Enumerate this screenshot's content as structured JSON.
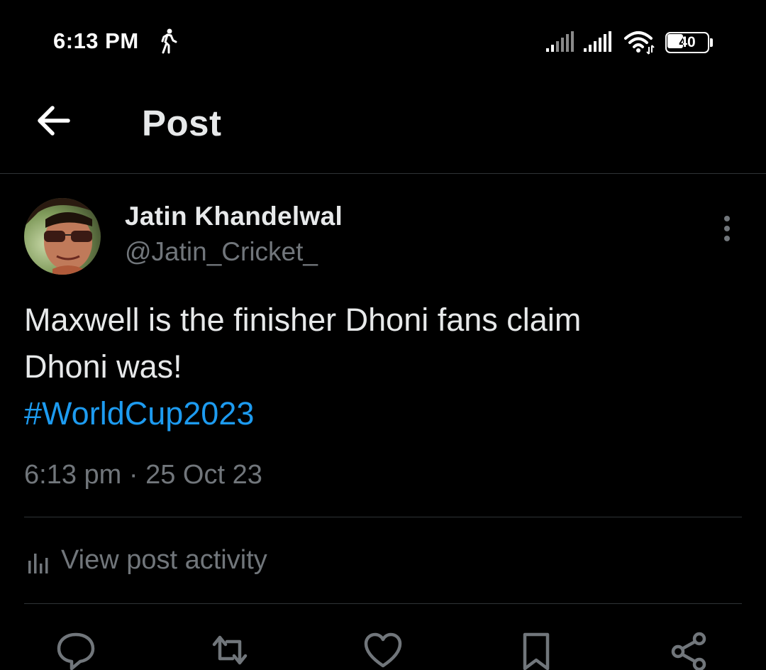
{
  "status_bar": {
    "time": "6:13 PM",
    "battery_level": "40",
    "icons": [
      "walk-icon",
      "signal-icon",
      "signal-icon",
      "wifi-icon",
      "battery-icon"
    ]
  },
  "header": {
    "title": "Post",
    "back_icon": "arrow-left-icon"
  },
  "post": {
    "author": {
      "display_name": "Jatin Khandelwal",
      "handle": "@Jatin_Cricket_"
    },
    "text_lines": [
      "Maxwell is the finisher Dhoni fans claim",
      "Dhoni was!"
    ],
    "hashtag": "#WorldCup2023",
    "timestamp": "6:13 pm · 25 Oct 23",
    "activity_label": "View post activity",
    "actions": [
      "reply-icon",
      "repost-icon",
      "like-icon",
      "bookmark-icon",
      "share-icon"
    ]
  },
  "colors": {
    "background": "#000000",
    "primary_text": "#e7e9ea",
    "secondary_text": "#71767b",
    "accent": "#1d9bf0",
    "divider": "#2f3336"
  }
}
